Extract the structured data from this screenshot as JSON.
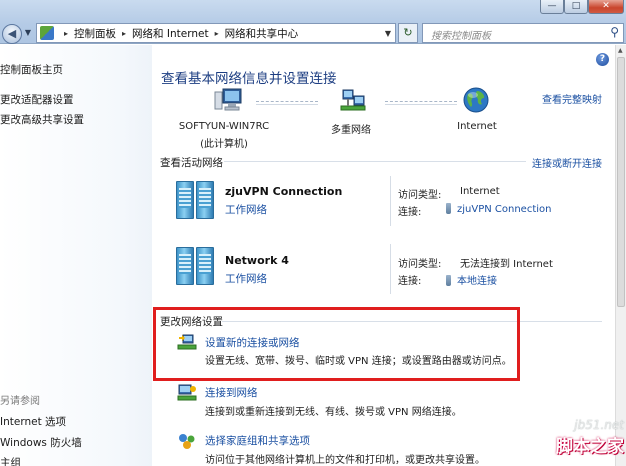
{
  "window": {
    "controls": {
      "minimize": "—",
      "maximize": "□",
      "close": "✕"
    }
  },
  "address_bar": {
    "back_glyph": "◀",
    "fwd_glyph": "▼",
    "breadcrumb": [
      "控制面板",
      "网络和 Internet",
      "网络和共享中心"
    ],
    "separator": "▸",
    "dropdown_glyph": "▼",
    "refresh_glyph": "↻",
    "search_placeholder": "搜索控制面板",
    "search_glyph": "⚲"
  },
  "sidebar": {
    "items": [
      {
        "label": "控制面板主页"
      },
      {
        "label": "更改适配器设置"
      },
      {
        "label": "更改高级共享设置"
      }
    ],
    "see_also_heading": "另请参阅",
    "see_also": [
      {
        "label": "Internet 选项"
      },
      {
        "label": "Windows 防火墙"
      },
      {
        "label": "主组"
      }
    ]
  },
  "main": {
    "help_glyph": "?",
    "title": "查看基本网络信息并设置连接",
    "view_full_map": "查看完整映射",
    "map": {
      "computer": {
        "name": "SOFTYUN-WIN7RC",
        "sub": "(此计算机)"
      },
      "middle": {
        "name": "多重网络"
      },
      "internet": {
        "name": "Internet"
      }
    },
    "active_networks": {
      "heading": "查看活动网络",
      "connect_link": "连接或断开连接",
      "networks": [
        {
          "name": "zjuVPN Connection",
          "category": "工作网络",
          "access_label": "访问类型:",
          "access_value": "Internet",
          "conn_label": "连接:",
          "conn_value": "zjuVPN Connection"
        },
        {
          "name": "Network  4",
          "category": "工作网络",
          "access_label": "访问类型:",
          "access_value": "无法连接到 Internet",
          "conn_label": "连接:",
          "conn_value": "本地连接"
        }
      ]
    },
    "change_settings": {
      "heading": "更改网络设置",
      "tasks": [
        {
          "title": "设置新的连接或网络",
          "desc": "设置无线、宽带、拨号、临时或 VPN 连接；或设置路由器或访问点。"
        },
        {
          "title": "连接到网络",
          "desc": "连接到或重新连接到无线、有线、拨号或 VPN 网络连接。"
        },
        {
          "title": "选择家庭组和共享选项",
          "desc": "访问位于其他网络计算机上的文件和打印机，或更改共享设置。"
        }
      ]
    }
  },
  "watermark": {
    "url": "jb51.net",
    "name": "脚本之家"
  },
  "colors": {
    "link": "#1b50a2",
    "title": "#1d3e82",
    "highlight": "#e01e1e"
  }
}
